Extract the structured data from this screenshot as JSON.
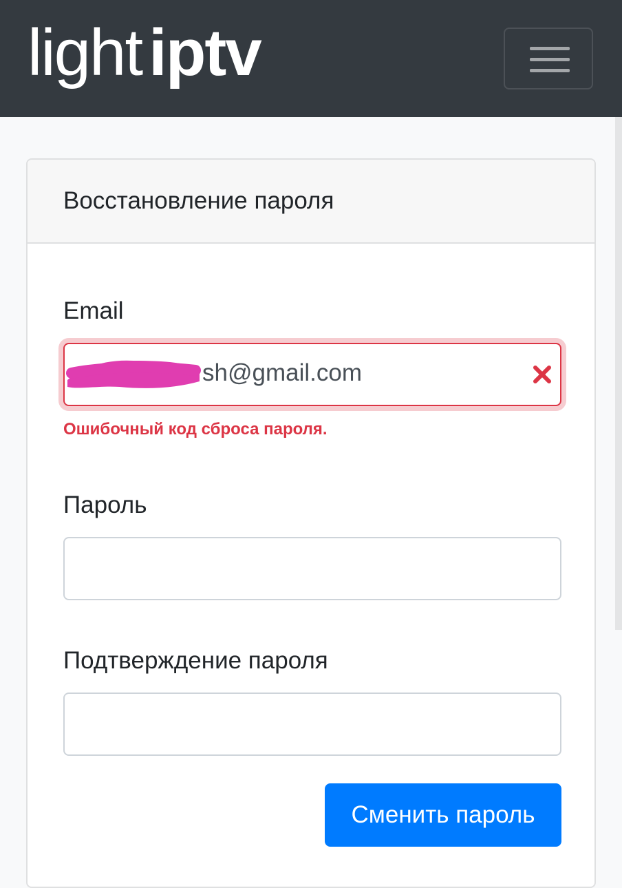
{
  "navbar": {
    "brand_light": "light",
    "brand_bold": "iptv",
    "menu_icon": "hamburger-menu-icon"
  },
  "card": {
    "title": "Восстановление пароля"
  },
  "form": {
    "email_label": "Email",
    "email_value_visible": "sh@gmail.com",
    "email_error_icon": "error-x-icon",
    "email_error": "Ошибочный код сброса пароля.",
    "password_label": "Пароль",
    "password_value": "",
    "confirm_label": "Подтверждение пароля",
    "confirm_value": "",
    "submit_label": "Сменить пароль"
  },
  "colors": {
    "navbar_bg": "#343a40",
    "primary": "#007bff",
    "danger": "#dc3545",
    "redaction": "#e03db0"
  }
}
